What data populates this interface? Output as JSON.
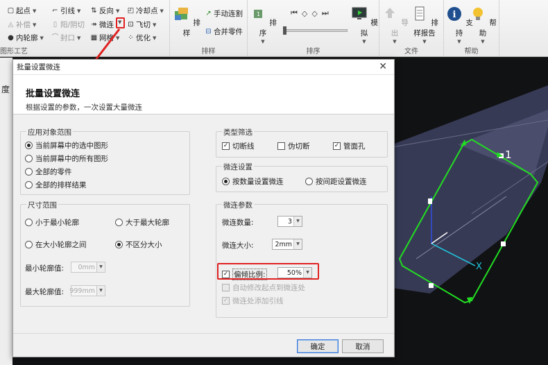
{
  "ribbon": {
    "edit": {
      "label": "图形工艺",
      "items": [
        {
          "label": "起点",
          "dis": false
        },
        {
          "label": "引线",
          "dis": false
        },
        {
          "label": "反向",
          "dis": false
        },
        {
          "label": "冷却点",
          "dis": false
        },
        {
          "label": "补偿",
          "dis": true
        },
        {
          "label": "阳/阴切",
          "dis": true
        },
        {
          "label": "微连",
          "dis": false
        },
        {
          "label": "飞切",
          "dis": false
        },
        {
          "label": "内轮廓",
          "dis": false
        },
        {
          "label": "封口",
          "dis": true
        },
        {
          "label": "网格",
          "dis": false
        },
        {
          "label": "优化",
          "dis": false
        }
      ]
    },
    "nest": {
      "label": "排样",
      "layout": "排样",
      "manual": "手动连割",
      "merge": "合并零件"
    },
    "sort": {
      "label": "排序",
      "sort": "排序",
      "simulate": "模拟"
    },
    "file": {
      "label": "文件",
      "export": "导出",
      "report": "排样报告"
    },
    "help": {
      "label": "帮助",
      "support": "支持",
      "help": "帮助"
    }
  },
  "workspace": {
    "left_text": "度",
    "part_label": "1",
    "axis_x": "X"
  },
  "dialog": {
    "title": "批量设置微连",
    "heading": "批量设置微连",
    "description": "根据设置的参数，一次设置大量微连",
    "scope": {
      "legend": "应用对象范围",
      "options": [
        "当前屏幕中的选中图形",
        "当前屏幕中的所有图形",
        "全部的零件",
        "全部的排样结果"
      ],
      "selected": 0
    },
    "size": {
      "legend": "尺寸范围",
      "options": [
        "小于最小轮廓",
        "大于最大轮廓",
        "在大小轮廓之间",
        "不区分大小"
      ],
      "selected": 3,
      "min_label": "最小轮廓值:",
      "min_value": "0mm",
      "max_label": "最大轮廓值:",
      "max_value": "999mm"
    },
    "type": {
      "legend": "类型筛选",
      "options": [
        {
          "label": "切断线",
          "checked": true
        },
        {
          "label": "伪切断",
          "checked": false
        },
        {
          "label": "管面孔",
          "checked": true
        }
      ]
    },
    "mode": {
      "legend": "微连设置",
      "options": [
        "按数量设置微连",
        "按间距设置微连"
      ],
      "selected": 0
    },
    "params": {
      "legend": "微连参数",
      "count_label": "微连数量:",
      "count_value": "3",
      "size_label": "微连大小:",
      "size_value": "2mm",
      "ratio_label": "偏倾比例:",
      "ratio_value": "50%",
      "ratio_checked": true,
      "auto_start": "自动修改起点到微连处",
      "add_lead": "微连处添加引线"
    },
    "ok": "确定",
    "cancel": "取消"
  },
  "colors": {
    "accent_red": "#e02020",
    "part_edge": "#22dd22",
    "part_fill": "#3c3f5c"
  }
}
